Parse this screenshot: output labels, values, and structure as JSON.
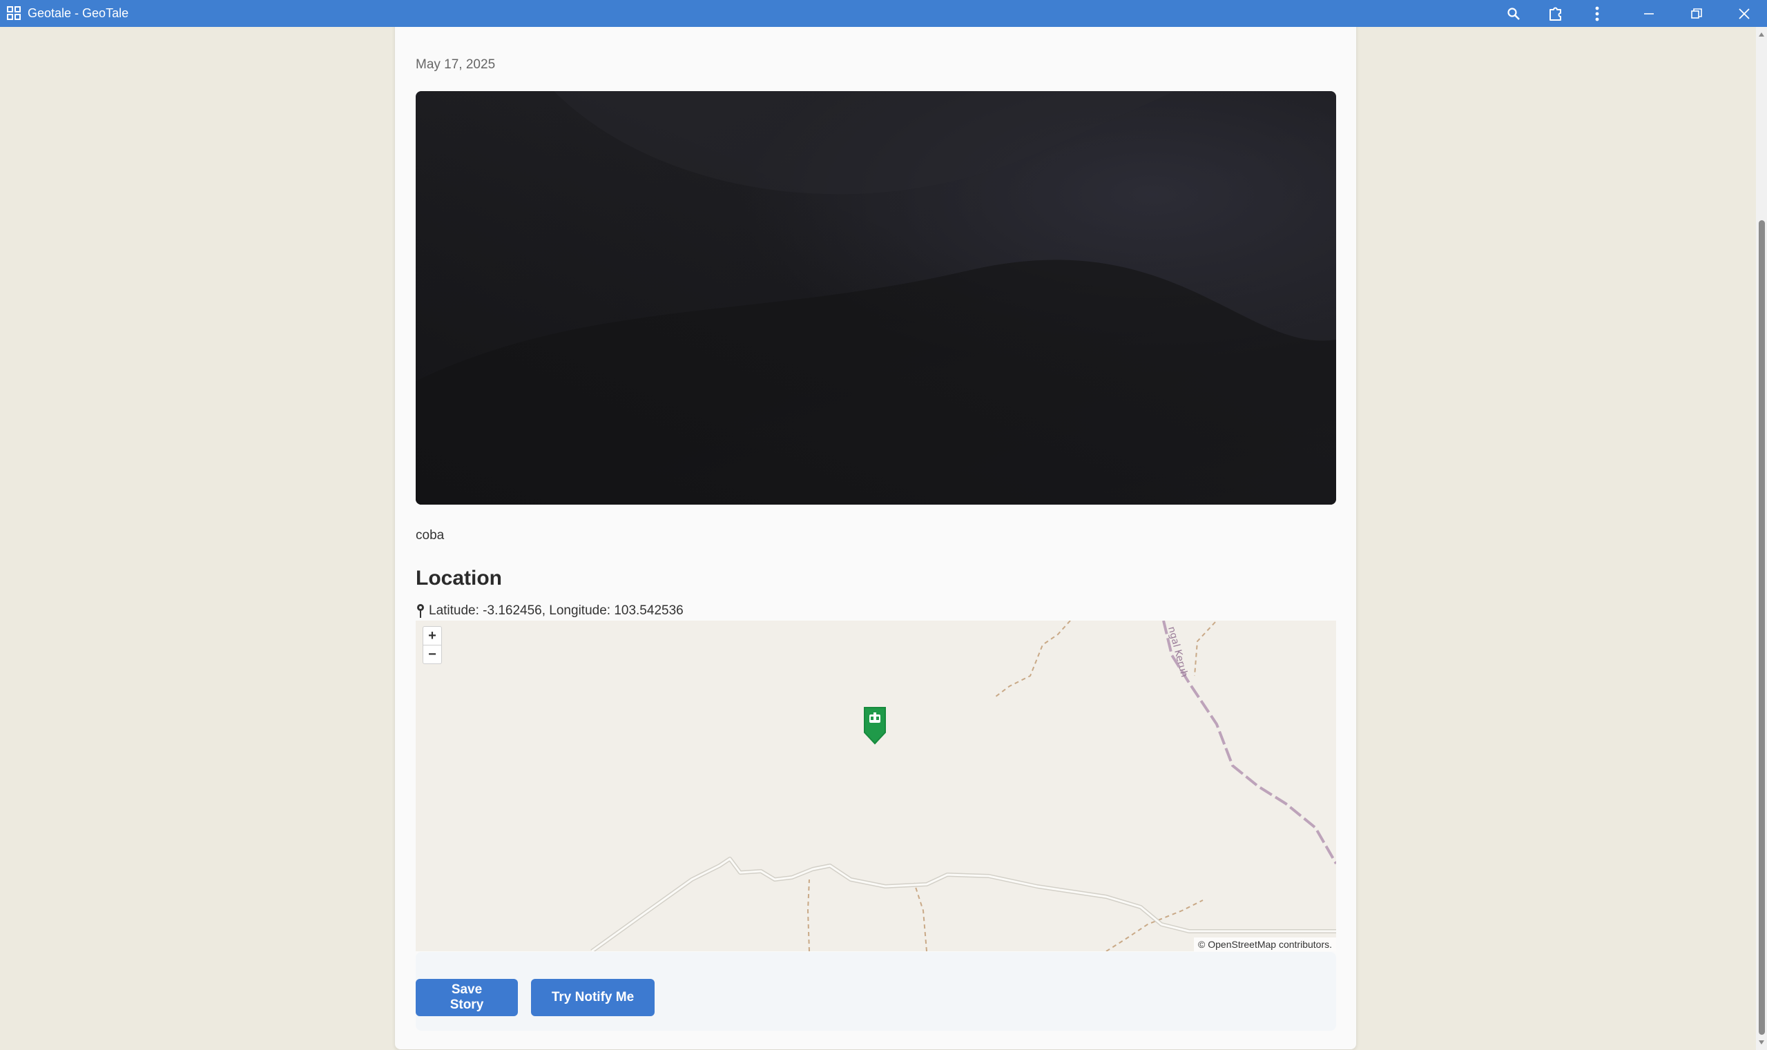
{
  "window": {
    "title": "Geotale - GeoTale",
    "icons": {
      "app": "app-grid-icon",
      "search": "search-icon",
      "extensions": "extension-icon",
      "menu": "more-vertical-icon",
      "minimize": "minimize-icon",
      "maximize": "restore-icon",
      "close": "close-icon"
    }
  },
  "story": {
    "date": "May 17, 2025",
    "image_alt": "story-photo",
    "description": "coba"
  },
  "location": {
    "heading": "Location",
    "coordinates_text": "Latitude: -3.162456, Longitude: 103.542536",
    "pin_icon": "map-pin-icon"
  },
  "map": {
    "zoom_in_label": "+",
    "zoom_out_label": "−",
    "road_label": "ngal Keruh",
    "attribution": "© OpenStreetMap contributors.",
    "marker_icon": "location-marker-icon",
    "colors": {
      "background": "#f2efe9",
      "marker": "#1f9a49",
      "boundary": "#b79ab5",
      "path": "#c9a987"
    }
  },
  "actions": {
    "save_label": "Save Story",
    "notify_label": "Try Notify Me"
  },
  "colors": {
    "titlebar": "#3f7fd1",
    "page_background": "#edeadf",
    "button": "#3d7ad0"
  }
}
